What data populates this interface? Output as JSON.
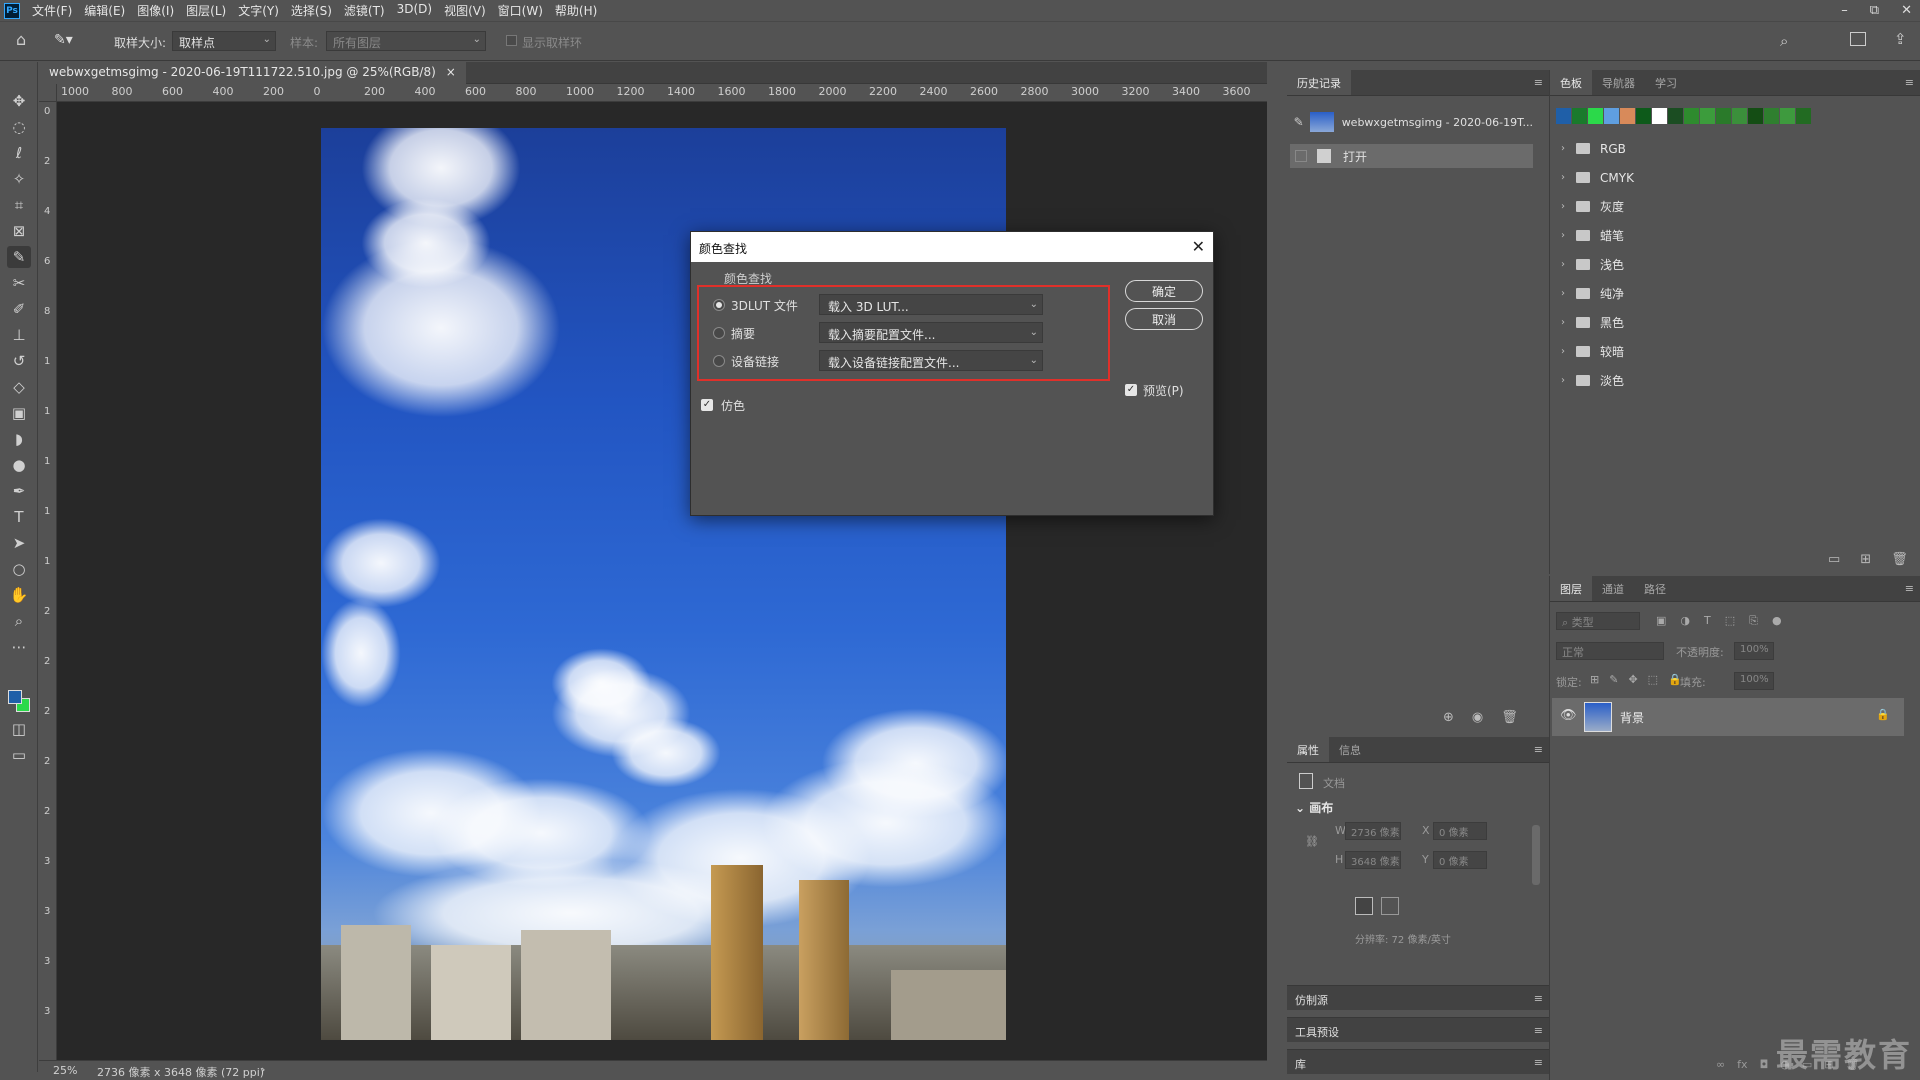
{
  "app": {
    "logo": "Ps"
  },
  "menu": [
    "文件(F)",
    "编辑(E)",
    "图像(I)",
    "图层(L)",
    "文字(Y)",
    "选择(S)",
    "滤镜(T)",
    "3D(D)",
    "视图(V)",
    "窗口(W)",
    "帮助(H)"
  ],
  "window_controls": [
    "–",
    "⧉",
    "✕"
  ],
  "options": {
    "sample_size_label": "取样大小:",
    "sample_size_value": "取样点",
    "sample_label": "样本:",
    "sample_value": "所有图层",
    "show_ring_label": "显示取样环"
  },
  "document": {
    "tab_title": "webwxgetmsgimg - 2020-06-19T111722.510.jpg @ 25%(RGB/8)",
    "tab_close": "×",
    "ruler_labels": [
      "1000",
      "800",
      "600",
      "400",
      "200",
      "0",
      "200",
      "400",
      "600",
      "800",
      "1000",
      "1200",
      "1400",
      "1600",
      "1800",
      "2000",
      "2200",
      "2400",
      "2600",
      "2800",
      "3000",
      "3200",
      "3400",
      "3600"
    ],
    "ruler_v_labels": [
      "0",
      "2",
      "4",
      "6",
      "8",
      "1",
      "1",
      "1",
      "1",
      "1",
      "2",
      "2",
      "2",
      "2",
      "2",
      "3",
      "3",
      "3",
      "3"
    ]
  },
  "status": {
    "zoom": "25%",
    "info": "2736 像素 x 3648 像素 (72 ppi)",
    "arrow": "›"
  },
  "history_panel": {
    "tab": "历史记录",
    "snapshot": "webwxgetmsgimg - 2020-06-19T...",
    "step": "打开"
  },
  "swatches_panel": {
    "tabs": [
      "色板",
      "导航器",
      "学习"
    ],
    "colors": [
      "#1f5fa8",
      "#1a7a2c",
      "#2bd94a",
      "#5f9fe0",
      "#d88a5a",
      "#0d5a1a",
      "#ffffff",
      "#1b4d22",
      "#2e8b2e",
      "#3c9c3c",
      "#2a7a2a",
      "#3b8f3b",
      "#144d14",
      "#2f7f2f",
      "#3e9a3e",
      "#226b22"
    ],
    "groups": [
      "RGB",
      "CMYK",
      "灰度",
      "蜡笔",
      "浅色",
      "纯净",
      "黑色",
      "较暗",
      "淡色"
    ]
  },
  "properties_panel": {
    "tabs": [
      "属性",
      "信息"
    ],
    "doc_label": "文档",
    "section": "画布",
    "w_label": "W",
    "w_value": "2736 像素",
    "h_label": "H",
    "h_value": "3648 像素",
    "x_label": "X",
    "x_value": "0 像素",
    "y_label": "Y",
    "y_value": "0 像素",
    "resolution": "分辨率: 72 像素/英寸"
  },
  "collapsed_panels": [
    "仿制源",
    "工具预设",
    "库"
  ],
  "layers_panel": {
    "tabs": [
      "图层",
      "通道",
      "路径"
    ],
    "filter_placeholder": "类型",
    "blend_mode": "正常",
    "opacity_label": "不透明度:",
    "opacity_value": "100%",
    "lock_label": "锁定:",
    "fill_label": "填充:",
    "fill_value": "100%",
    "layer_name": "背景"
  },
  "dialog": {
    "title": "颜色查找",
    "group_label": "颜色查找",
    "rows": [
      {
        "label": "3DLUT 文件",
        "value": "载入 3D LUT...",
        "selected": true
      },
      {
        "label": "摘要",
        "value": "载入摘要配置文件...",
        "selected": false
      },
      {
        "label": "设备链接",
        "value": "载入设备链接配置文件...",
        "selected": false
      }
    ],
    "dither_label": "仿色",
    "ok_label": "确定",
    "cancel_label": "取消",
    "preview_label": "预览(P)"
  },
  "watermark": "最需教育"
}
